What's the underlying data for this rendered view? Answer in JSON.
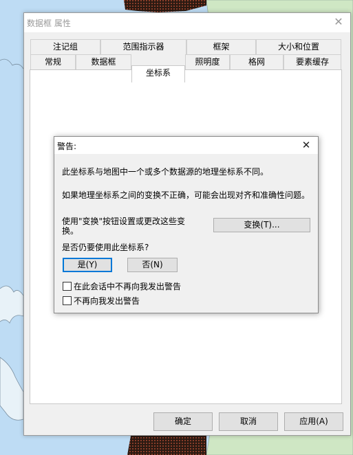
{
  "properties_window": {
    "title": "数据框 属性",
    "tabs_row_top": [
      "注记组",
      "范围指示器",
      "框架",
      "大小和位置"
    ],
    "tabs_row_bottom": [
      "常规",
      "数据框",
      "坐标系",
      "照明度",
      "格网",
      "要素缓存"
    ],
    "active_tab": "坐标系",
    "buttons": {
      "ok": "确定",
      "cancel": "取消",
      "apply": "应用(A)"
    }
  },
  "warning_dialog": {
    "title": "警告:",
    "message1": "此坐标系与地图中一个或多个数据源的地理坐标系不同。",
    "message2": "如果地理坐标系之间的变换不正确，可能会出现对齐和准确性问题。",
    "transform_hint": "使用\"变换\"按钮设置或更改这些变换。",
    "transform_button": "变换(T)...",
    "question": "是否仍要使用此坐标系?",
    "yes_button": "是(Y)",
    "no_button": "否(N)",
    "checkbox_session": "在此会话中不再向我发出警告",
    "checkbox_never": "不再向我发出警告"
  },
  "colors": {
    "water": "#bedcf4",
    "land": "#cfe7c4",
    "hatched_region": "#6b3a2a",
    "default_button_border": "#0078d7"
  }
}
